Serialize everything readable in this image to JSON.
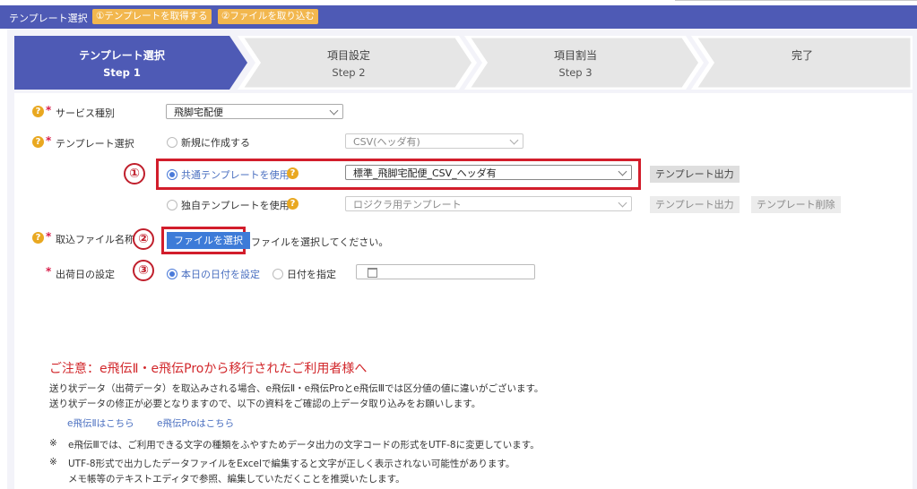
{
  "header": {
    "title": "テンプレート選択",
    "badges": [
      "①テンプレートを取得する",
      "②ファイルを取り込む"
    ]
  },
  "wizard": {
    "steps": [
      {
        "label": "テンプレート選択",
        "sub": "Step 1",
        "active": true
      },
      {
        "label": "項目設定",
        "sub": "Step 2",
        "active": false
      },
      {
        "label": "項目割当",
        "sub": "Step 3",
        "active": false
      },
      {
        "label": "完了",
        "sub": "",
        "active": false
      }
    ],
    "active_color": "#4e5ab5",
    "inactive_color": "#e6e6e6"
  },
  "form": {
    "service_label": "サービス種別",
    "service_value": "飛脚宅配便",
    "template_label": "テンプレート選択",
    "new_label": "新規に作成する",
    "new_select": "CSV(ヘッダ有)",
    "common_label": "共通テンプレートを使用",
    "common_select": "標準_飛脚宅配便_CSV_ヘッダ有",
    "common_output_btn": "テンプレート出力",
    "own_label": "独自テンプレートを使用",
    "own_select": "ロジクラ用テンプレート",
    "own_output_btn": "テンプレート出力",
    "own_delete_btn": "テンプレート削除",
    "file_label": "取込ファイル名称",
    "file_btn": "ファイルを選択",
    "file_status": "ファイルを選択してください。",
    "ship_label": "出荷日の設定",
    "today_label": "本日の日付を設定",
    "specify_label": "日付を指定"
  },
  "markers": [
    "①",
    "②",
    "③"
  ],
  "notice": {
    "title": "ご注意：e飛伝Ⅱ・e飛伝Proから移行されたご利用者様へ",
    "line1": "送り状データ（出荷データ）を取込みされる場合、e飛伝Ⅱ・e飛伝Proとe飛伝Ⅲでは区分値の値に違いがございます。",
    "line2": "送り状データの修正が必要となりますので、以下の資料をご確認の上データ取り込みをお願いします。",
    "link1": "e飛伝Ⅱはこちら",
    "link2": "e飛伝Proはこちら",
    "mark1": "※",
    "note1": "e飛伝Ⅲでは、ご利用できる文字の種類をふやすためデータ出力の文字コードの形式をUTF-8に変更しています。",
    "mark2": "※",
    "note2": "UTF-8形式で出力したデータファイルをExcelで編集すると文字が正しく表示されない可能性があります。",
    "note3": "メモ帳等のテキストエディタで参照、編集していただくことを推奨いたします。"
  },
  "colors": {
    "accent": "#4e5ab5",
    "badge": "#f2b74e",
    "required": "#d81e4a",
    "highlight": "#d21d2b",
    "notice": "#d2282c"
  }
}
